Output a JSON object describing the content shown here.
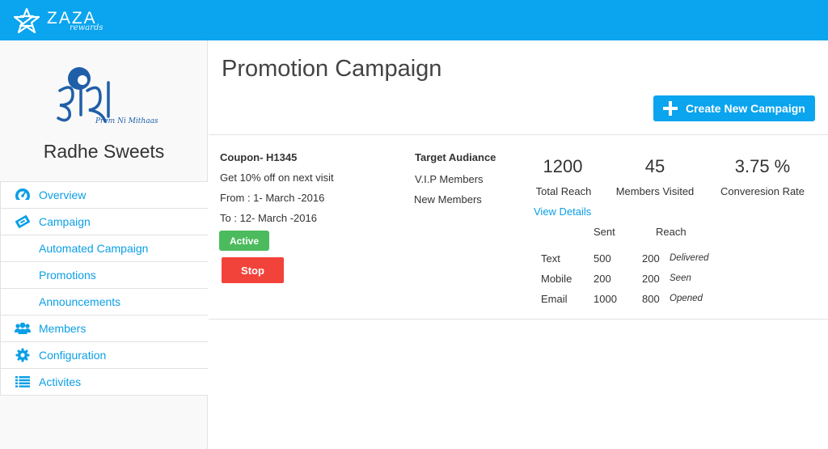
{
  "brand": {
    "name": "ZAZA",
    "sub": "rewards"
  },
  "store": {
    "name": "Radhe Sweets",
    "logo_tagline": "Prem Ni Mithaas"
  },
  "sidebar": {
    "items": [
      {
        "label": "Overview",
        "icon": "dashboard-icon"
      },
      {
        "label": "Campaign",
        "icon": "ticket-icon"
      },
      {
        "label": "Automated Campaign"
      },
      {
        "label": "Promotions"
      },
      {
        "label": "Announcements"
      },
      {
        "label": "Members",
        "icon": "users-icon"
      },
      {
        "label": "Configuration",
        "icon": "gear-icon"
      },
      {
        "label": "Activites",
        "icon": "list-icon"
      }
    ]
  },
  "main": {
    "title": "Promotion Campaign",
    "create_label": "Create New Campaign"
  },
  "campaign": {
    "coupon": "Coupon- H1345",
    "offer": "Get 10% off on next visit",
    "from": "From : 1- March -2016",
    "to": "To : 12- March -2016",
    "status": "Active",
    "stop_label": "Stop",
    "target_title": "Target Audiance",
    "targets": [
      "V.I.P Members",
      "New Members"
    ],
    "stats": [
      {
        "value": "1200",
        "label": "Total Reach"
      },
      {
        "value": "45",
        "label": "Members Visited"
      },
      {
        "value": "3.75 %",
        "label": "Converesion Rate"
      }
    ],
    "view_details": "View Details",
    "channel_headers": {
      "sent": "Sent",
      "reach": "Reach"
    },
    "channels": [
      {
        "name": "Text",
        "sent": "500",
        "reach": "200",
        "status": "Delivered"
      },
      {
        "name": "Mobile",
        "sent": "200",
        "reach": "200",
        "status": "Seen"
      },
      {
        "name": "Email",
        "sent": "1000",
        "reach": "800",
        "status": "Opened"
      }
    ]
  },
  "colors": {
    "accent": "#0aa4ef",
    "active": "#4cbb5e",
    "stop": "#f2433a",
    "link": "#0a9fe6"
  }
}
